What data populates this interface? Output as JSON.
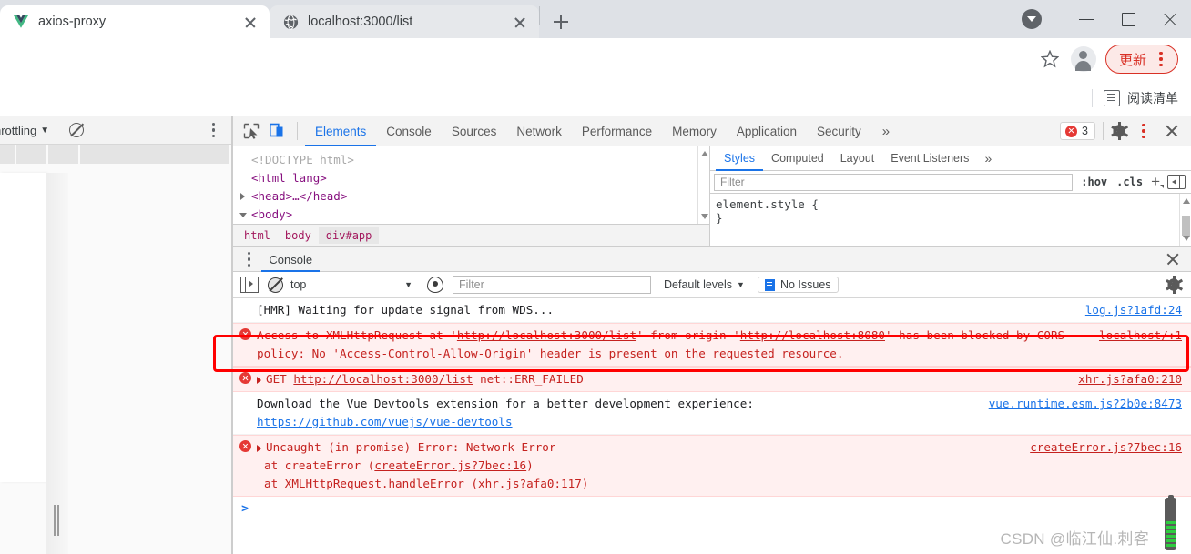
{
  "browser": {
    "tabs": [
      {
        "title": "axios-proxy",
        "icon": "vue-logo-icon",
        "active": true
      },
      {
        "title": "localhost:3000/list",
        "icon": "globe-icon",
        "active": false
      }
    ],
    "new_tab_label": "+",
    "window_controls": {
      "minimize": "–",
      "maximize": "□",
      "close": "×"
    },
    "toolbar": {
      "star_icon": "star-icon",
      "profile_icon": "avatar-icon",
      "update_label": "更新",
      "update_color": "#d93025",
      "menu_icon": "kebab-menu-icon"
    },
    "bookmark_bar": {
      "reading_list_label": "阅读清单",
      "reading_list_icon": "reading-list-icon"
    }
  },
  "left_panel": {
    "throttle_label": "hrottling",
    "throttle_caret": "▼",
    "clear_icon": "clear-network-icon",
    "menu_icon": "kebab-menu-icon"
  },
  "devtools": {
    "inspect_icon": "inspect-element-icon",
    "device_icon": "device-toolbar-icon",
    "tabs": [
      {
        "label": "Elements",
        "active": true
      },
      {
        "label": "Console",
        "active": false
      },
      {
        "label": "Sources",
        "active": false
      },
      {
        "label": "Network",
        "active": false
      },
      {
        "label": "Performance",
        "active": false
      },
      {
        "label": "Memory",
        "active": false
      },
      {
        "label": "Application",
        "active": false
      },
      {
        "label": "Security",
        "active": false
      }
    ],
    "more_tabs": "»",
    "error_count": "3",
    "settings_icon": "gear-icon",
    "main_menu_icon": "kebab-menu-icon",
    "close_icon": "close-icon",
    "elements": {
      "lines": [
        {
          "text": "<!DOCTYPE html>",
          "kind": "doctype",
          "tri": "none"
        },
        {
          "text": "<html lang>",
          "kind": "tag",
          "tri": "none"
        },
        {
          "text": "<head>…</head>",
          "kind": "tag",
          "tri": "closed"
        },
        {
          "text": "<body>",
          "kind": "tag",
          "tri": "open"
        }
      ],
      "breadcrumbs": [
        {
          "label": "html",
          "selected": false
        },
        {
          "label": "body",
          "selected": false
        },
        {
          "label": "div#app",
          "selected": true
        }
      ]
    },
    "styles": {
      "tabs": [
        {
          "label": "Styles",
          "active": true
        },
        {
          "label": "Computed",
          "active": false
        },
        {
          "label": "Layout",
          "active": false
        },
        {
          "label": "Event Listeners",
          "active": false
        }
      ],
      "more_tabs": "»",
      "filter_placeholder": "Filter",
      "hov_label": ":hov",
      "cls_label": ".cls",
      "plus_label": "+",
      "rule_open": "element.style {",
      "rule_close": "}"
    }
  },
  "drawer": {
    "tab_label": "Console",
    "close_icon": "close-icon",
    "menu_icon": "kebab-menu-icon",
    "toolbar": {
      "sidebar_icon": "console-sidebar-icon",
      "clear_icon": "clear-console-icon",
      "context_value": "top",
      "context_caret": "▼",
      "eye_icon": "live-expression-icon",
      "filter_placeholder": "Filter",
      "levels_label": "Default levels",
      "levels_caret": "▼",
      "issues_label": "No Issues",
      "issues_icon": "issues-icon",
      "settings_icon": "gear-icon"
    },
    "messages": [
      {
        "type": "log",
        "text": "[HMR] Waiting for update signal from WDS...",
        "source": "log.js?1afd:24"
      },
      {
        "type": "error",
        "highlighted": true,
        "parts": [
          {
            "t": "Access to XMLHttpRequest at '",
            "link": false
          },
          {
            "t": "http://localhost:3000/list",
            "link": true
          },
          {
            "t": "' from origin '",
            "link": false
          },
          {
            "t": "http://localhost:8080",
            "link": true
          },
          {
            "t": "' has been blocked by CORS policy: No 'Access-Control-Allow-Origin' header is present on the requested resource.",
            "link": false
          }
        ],
        "source": "localhost/:1"
      },
      {
        "type": "error",
        "expandable": true,
        "parts": [
          {
            "t": "GET ",
            "link": false
          },
          {
            "t": "http://localhost:3000/list",
            "link": true
          },
          {
            "t": " net::ERR_FAILED",
            "link": false
          }
        ],
        "source": "xhr.js?afa0:210"
      },
      {
        "type": "log",
        "text": "Download the Vue Devtools extension for a better development experience:",
        "link_text": "https://github.com/vuejs/vue-devtools",
        "source": "vue.runtime.esm.js?2b0e:8473"
      },
      {
        "type": "error",
        "expandable": true,
        "text": "Uncaught (in promise) Error: Network Error",
        "stack": [
          {
            "pre": "at createError (",
            "link": "createError.js?7bec:16",
            "post": ")"
          },
          {
            "pre": "at XMLHttpRequest.handleError (",
            "link": "xhr.js?afa0:117",
            "post": ")"
          }
        ],
        "source": "createError.js?7bec:16"
      }
    ],
    "prompt_symbol": ">"
  },
  "watermark": {
    "text": "CSDN @临江仙.刺客"
  }
}
